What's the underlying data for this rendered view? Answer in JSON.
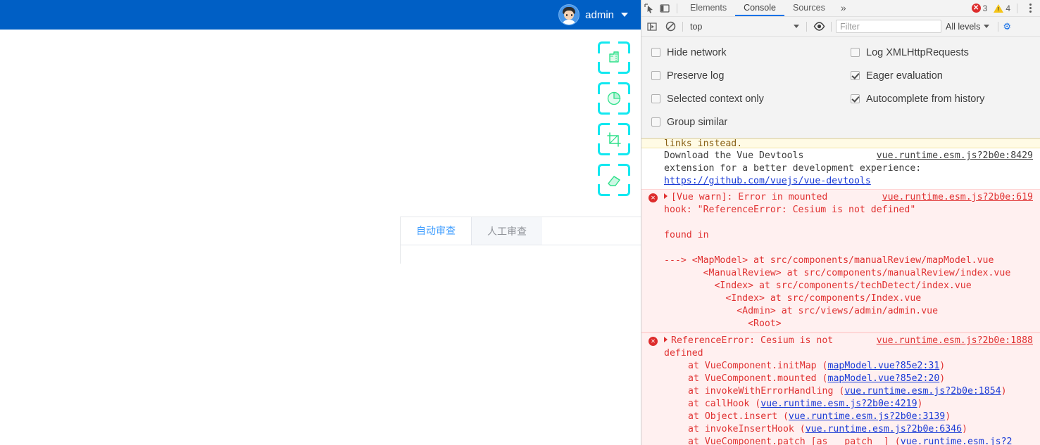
{
  "app": {
    "header": {
      "user_name": "admin",
      "avatar_icon": "user-avatar",
      "caret_icon": "chevron-down-icon"
    },
    "brand_color": "#005fc5",
    "tools": [
      {
        "name": "measure-tool",
        "icon": "ruler-icon"
      },
      {
        "name": "area-tool",
        "icon": "pie-chart-icon"
      },
      {
        "name": "crop-tool",
        "icon": "crop-icon"
      },
      {
        "name": "erase-tool",
        "icon": "eraser-icon"
      }
    ],
    "tool_color": "#12e8f0",
    "panel": {
      "tabs": [
        {
          "label": "自动审查",
          "active": true
        },
        {
          "label": "人工审查",
          "active": false
        }
      ]
    }
  },
  "devtools": {
    "tabbar": {
      "inspect_icon": "inspect-cursor-icon",
      "device_icon": "device-toolbar-icon",
      "tabs": [
        {
          "label": "Elements",
          "selected": false
        },
        {
          "label": "Console",
          "selected": true
        },
        {
          "label": "Sources",
          "selected": false
        }
      ],
      "more_label": "»",
      "error_count": "3",
      "warning_count": "4",
      "menu_icon": "kebab-menu-icon"
    },
    "toolbar": {
      "sidebar_icon": "console-sidebar-icon",
      "clear_icon": "clear-console-icon",
      "context_value": "top",
      "context_caret_icon": "chevron-down-icon",
      "eye_icon": "live-expression-eye-icon",
      "filter_placeholder": "Filter",
      "filter_value": "",
      "levels_label": "All levels",
      "levels_caret_icon": "chevron-down-icon",
      "settings_icon": "settings-gear-icon"
    },
    "settings": {
      "left": [
        {
          "label": "Hide network",
          "checked": false
        },
        {
          "label": "Preserve log",
          "checked": false
        },
        {
          "label": "Selected context only",
          "checked": false
        },
        {
          "label": "Group similar",
          "checked": false
        }
      ],
      "right": [
        {
          "label": "Log XMLHttpRequests",
          "checked": false
        },
        {
          "label": "Eager evaluation",
          "checked": true
        },
        {
          "label": "Autocomplete from history",
          "checked": true
        }
      ]
    },
    "messages": {
      "clipped_warning_text": "links instead.",
      "devtools_tip": {
        "line1": "Download the Vue Devtools",
        "line2": "extension for a better development experience:",
        "link": "https://github.com/vuejs/vue-devtools",
        "source": "vue.runtime.esm.js?2b0e:8429"
      },
      "vue_warn": {
        "line1": "[Vue warn]: Error in mounted",
        "line2": "hook: \"ReferenceError: Cesium is not defined\"",
        "source": "vue.runtime.esm.js?2b0e:619",
        "found_in": "found in",
        "trace": [
          "---> <MapModel> at src/components/manualReview/mapModel.vue",
          "       <ManualReview> at src/components/manualReview/index.vue",
          "         <Index> at src/components/techDetect/index.vue",
          "           <Index> at src/components/Index.vue",
          "             <Admin> at src/views/admin/admin.vue",
          "               <Root>"
        ]
      },
      "reference_error": {
        "line1": "ReferenceError: Cesium is not",
        "line2": "defined",
        "source": "vue.runtime.esm.js?2b0e:1888",
        "stack": [
          {
            "text": "at VueComponent.initMap (",
            "link": "mapModel.vue?85e2:31",
            "tail": ")"
          },
          {
            "text": "at VueComponent.mounted (",
            "link": "mapModel.vue?85e2:20",
            "tail": ")"
          },
          {
            "text": "at invokeWithErrorHandling (",
            "link": "vue.runtime.esm.js?2b0e:1854",
            "tail": ")"
          },
          {
            "text": "at callHook (",
            "link": "vue.runtime.esm.js?2b0e:4219",
            "tail": ")"
          },
          {
            "text": "at Object.insert (",
            "link": "vue.runtime.esm.js?2b0e:3139",
            "tail": ")"
          },
          {
            "text": "at invokeInsertHook (",
            "link": "vue.runtime.esm.js?2b0e:6346",
            "tail": ")"
          },
          {
            "text": "at VueComponent.patch [as __patch__] (",
            "link": "vue.runtime.esm.js?2",
            "tail": ""
          }
        ]
      }
    }
  }
}
